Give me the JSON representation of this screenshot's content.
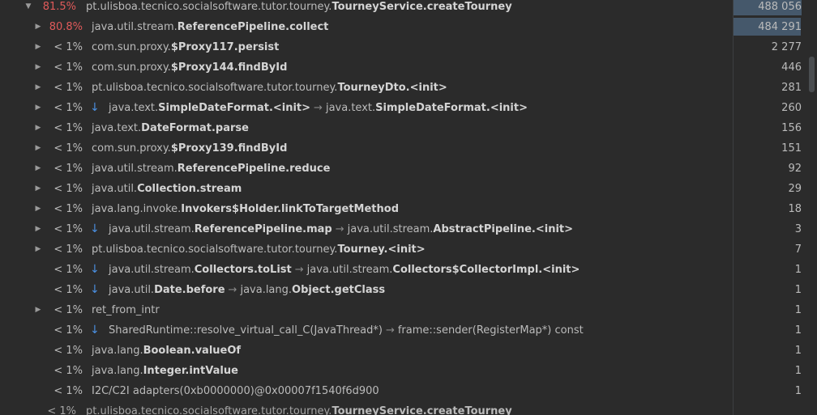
{
  "rows": [
    {
      "indent": 0,
      "expand": "down",
      "pct": "81.5%",
      "hot": true,
      "pkg": "pt.ulisboa.tecnico.socialsoftware.tutor.tourney.",
      "method": "TourneyService.createTourney",
      "count": "488 056",
      "bar": 1.0
    },
    {
      "indent": 1,
      "expand": "right",
      "pct": "80.8%",
      "hot": true,
      "pkg": "java.util.stream.",
      "method": "ReferencePipeline.collect",
      "count": "484 291",
      "bar": 0.99
    },
    {
      "indent": 1,
      "expand": "right",
      "pct": "< 1%",
      "pkg": "com.sun.proxy.",
      "method": "$Proxy117.persist",
      "count": "2 277"
    },
    {
      "indent": 1,
      "expand": "right",
      "pct": "< 1%",
      "pkg": "com.sun.proxy.",
      "method": "$Proxy144.findById",
      "count": "446"
    },
    {
      "indent": 1,
      "expand": "right",
      "pct": "< 1%",
      "pkg": "pt.ulisboa.tecnico.socialsoftware.tutor.tourney.",
      "method": "TourneyDto.<init>",
      "count": "281"
    },
    {
      "indent": 1,
      "expand": "right",
      "pct": "< 1%",
      "down": true,
      "pkg": "java.text.",
      "method": "SimpleDateFormat.<init>",
      "arrow_pkg": "java.text.",
      "arrow_method": "SimpleDateFormat.<init>",
      "count": "260"
    },
    {
      "indent": 1,
      "expand": "right",
      "pct": "< 1%",
      "pkg": "java.text.",
      "method": "DateFormat.parse",
      "count": "156"
    },
    {
      "indent": 1,
      "expand": "right",
      "pct": "< 1%",
      "pkg": "com.sun.proxy.",
      "method": "$Proxy139.findById",
      "count": "151"
    },
    {
      "indent": 1,
      "expand": "right",
      "pct": "< 1%",
      "pkg": "java.util.stream.",
      "method": "ReferencePipeline.reduce",
      "count": "92"
    },
    {
      "indent": 1,
      "expand": "right",
      "pct": "< 1%",
      "pkg": "java.util.",
      "method": "Collection.stream",
      "count": "29"
    },
    {
      "indent": 1,
      "expand": "right",
      "pct": "< 1%",
      "pkg": "java.lang.invoke.",
      "method": "Invokers$Holder.linkToTargetMethod",
      "count": "18"
    },
    {
      "indent": 1,
      "expand": "right",
      "pct": "< 1%",
      "down": true,
      "pkg": "java.util.stream.",
      "method": "ReferencePipeline.map",
      "arrow_pkg": "java.util.stream.",
      "arrow_method": "AbstractPipeline.<init>",
      "count": "3"
    },
    {
      "indent": 1,
      "expand": "right",
      "pct": "< 1%",
      "pkg": "pt.ulisboa.tecnico.socialsoftware.tutor.tourney.",
      "method": "Tourney.<init>",
      "count": "7"
    },
    {
      "indent": 1,
      "expand": "none",
      "pct": "< 1%",
      "down": true,
      "pkg": "java.util.stream.",
      "method": "Collectors.toList",
      "arrow_pkg": "java.util.stream.",
      "arrow_method": "Collectors$CollectorImpl.<init>",
      "count": "1"
    },
    {
      "indent": 1,
      "expand": "none",
      "pct": "< 1%",
      "down": true,
      "pkg": "java.util.",
      "method": "Date.before",
      "arrow_pkg": "java.lang.",
      "arrow_method": "Object.getClass",
      "count": "1"
    },
    {
      "indent": 1,
      "expand": "right",
      "pct": "< 1%",
      "pkg": "ret_from_intr",
      "method": "",
      "count": "1"
    },
    {
      "indent": 1,
      "expand": "none",
      "pct": "< 1%",
      "down": true,
      "pkg": "SharedRuntime::resolve_virtual_call_C(JavaThread*)",
      "method": "",
      "arrow_pkg": "frame::sender(RegisterMap*) const",
      "arrow_method": "",
      "count": "1"
    },
    {
      "indent": 1,
      "expand": "none",
      "pct": "< 1%",
      "pkg": "java.lang.",
      "method": "Boolean.valueOf",
      "count": "1"
    },
    {
      "indent": 1,
      "expand": "none",
      "pct": "< 1%",
      "pkg": "java.lang.",
      "method": "Integer.intValue",
      "count": "1"
    },
    {
      "indent": 1,
      "expand": "none",
      "pct": "< 1%",
      "pkg": "I2C/C2I adapters(0xb0000000)@0x00007f1540f6d900",
      "method": "",
      "count": "1"
    },
    {
      "indent": 0,
      "expand": "none",
      "pct": "< 1%",
      "pkg": "pt.ulisboa.tecnico.socialsoftware.tutor.tourney.",
      "method": "TourneyService.createTourney",
      "count": "",
      "partial": true
    }
  ],
  "colors": {
    "hot": "#e05a5a",
    "arrow_down": "#4a8fe0",
    "bar": "#45586b"
  },
  "icons": {
    "expanded": "triangle-down-icon",
    "collapsed": "triangle-right-icon",
    "call": "arrow-down-icon"
  }
}
